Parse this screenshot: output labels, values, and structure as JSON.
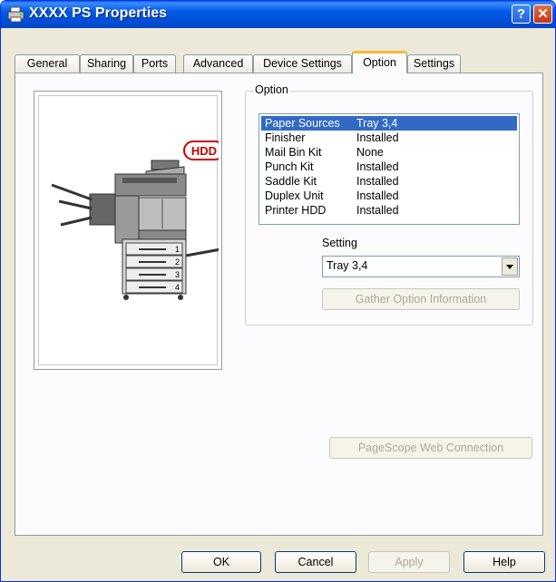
{
  "window": {
    "title": "XXXX PS Properties",
    "help_glyph": "?",
    "close_glyph": "✕"
  },
  "tabs": [
    {
      "label": "General"
    },
    {
      "label": "Sharing"
    },
    {
      "label": "Ports"
    },
    {
      "label": "Advanced"
    },
    {
      "label": "Device Settings"
    },
    {
      "label": "Option",
      "active": true
    },
    {
      "label": "Settings"
    }
  ],
  "preview": {
    "hdd_badge": "HDD",
    "tray_numbers": [
      "1",
      "2",
      "3",
      "4"
    ]
  },
  "option_group": {
    "label": "Option",
    "items": [
      {
        "name": "Paper Sources",
        "value": "Tray 3,4",
        "selected": true
      },
      {
        "name": "Finisher",
        "value": "Installed"
      },
      {
        "name": "Mail Bin Kit",
        "value": "None"
      },
      {
        "name": "Punch Kit",
        "value": "Installed"
      },
      {
        "name": "Saddle Kit",
        "value": "Installed"
      },
      {
        "name": "Duplex Unit",
        "value": "Installed"
      },
      {
        "name": "Printer HDD",
        "value": "Installed"
      }
    ],
    "setting_label": "Setting",
    "setting_value": "Tray 3,4",
    "gather_button": "Gather Option Information"
  },
  "pagescope_button": "PageScope Web Connection",
  "footer": {
    "ok": "OK",
    "cancel": "Cancel",
    "apply": "Apply",
    "help": "Help"
  }
}
